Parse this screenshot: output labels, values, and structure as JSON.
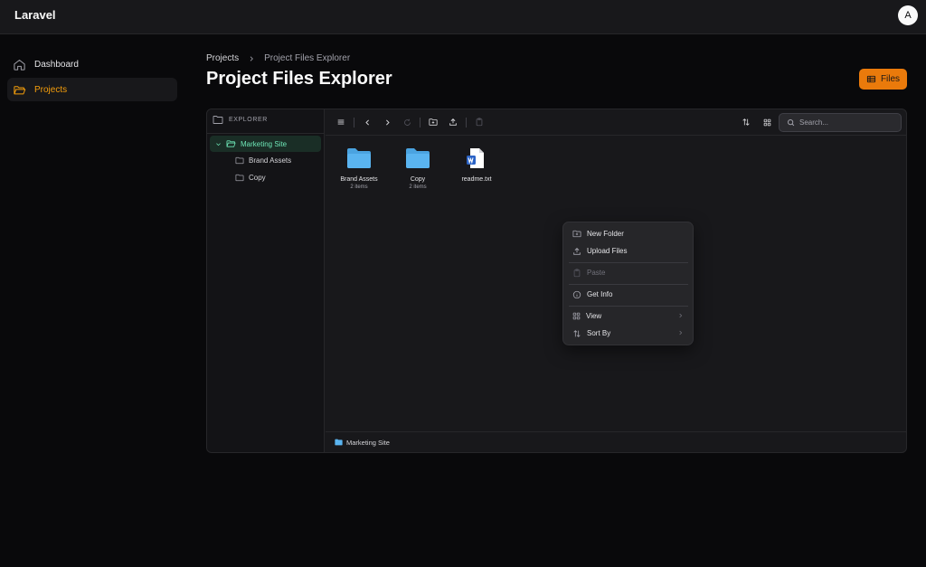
{
  "header": {
    "brand": "Laravel",
    "avatar_initial": "A"
  },
  "sidebar": {
    "items": [
      {
        "label": "Dashboard",
        "icon": "home-icon",
        "active": false
      },
      {
        "label": "Projects",
        "icon": "folder-open-icon",
        "active": true
      }
    ]
  },
  "breadcrumb": {
    "parent": "Projects",
    "current": "Project Files Explorer"
  },
  "page": {
    "title": "Project Files Explorer",
    "files_button": "Files"
  },
  "explorer": {
    "tree": {
      "heading": "EXPLORER",
      "root": "Marketing Site",
      "children": [
        "Brand Assets",
        "Copy"
      ]
    },
    "toolbar": {
      "search_placeholder": "Search..."
    },
    "items": [
      {
        "name": "Brand Assets",
        "meta": "2 items",
        "type": "folder"
      },
      {
        "name": "Copy",
        "meta": "2 items",
        "type": "folder"
      },
      {
        "name": "readme.txt",
        "meta": "",
        "type": "word-document"
      }
    ],
    "status": {
      "path": "Marketing Site"
    }
  },
  "context_menu": {
    "items": [
      {
        "label": "New Folder",
        "icon": "folder-plus-icon",
        "disabled": false
      },
      {
        "label": "Upload Files",
        "icon": "upload-icon",
        "disabled": false
      },
      {
        "label": "Paste",
        "icon": "paste-icon",
        "disabled": true
      },
      {
        "label": "Get Info",
        "icon": "info-icon",
        "disabled": false
      },
      {
        "label": "View",
        "icon": "grid-icon",
        "disabled": false,
        "submenu": true
      },
      {
        "label": "Sort By",
        "icon": "sort-icon",
        "disabled": false,
        "submenu": true
      }
    ]
  },
  "colors": {
    "accent": "#f59e0b",
    "button": "#ea7a0b",
    "folder": "#5ab4f0",
    "selected_tree": "#6ee7b7"
  }
}
